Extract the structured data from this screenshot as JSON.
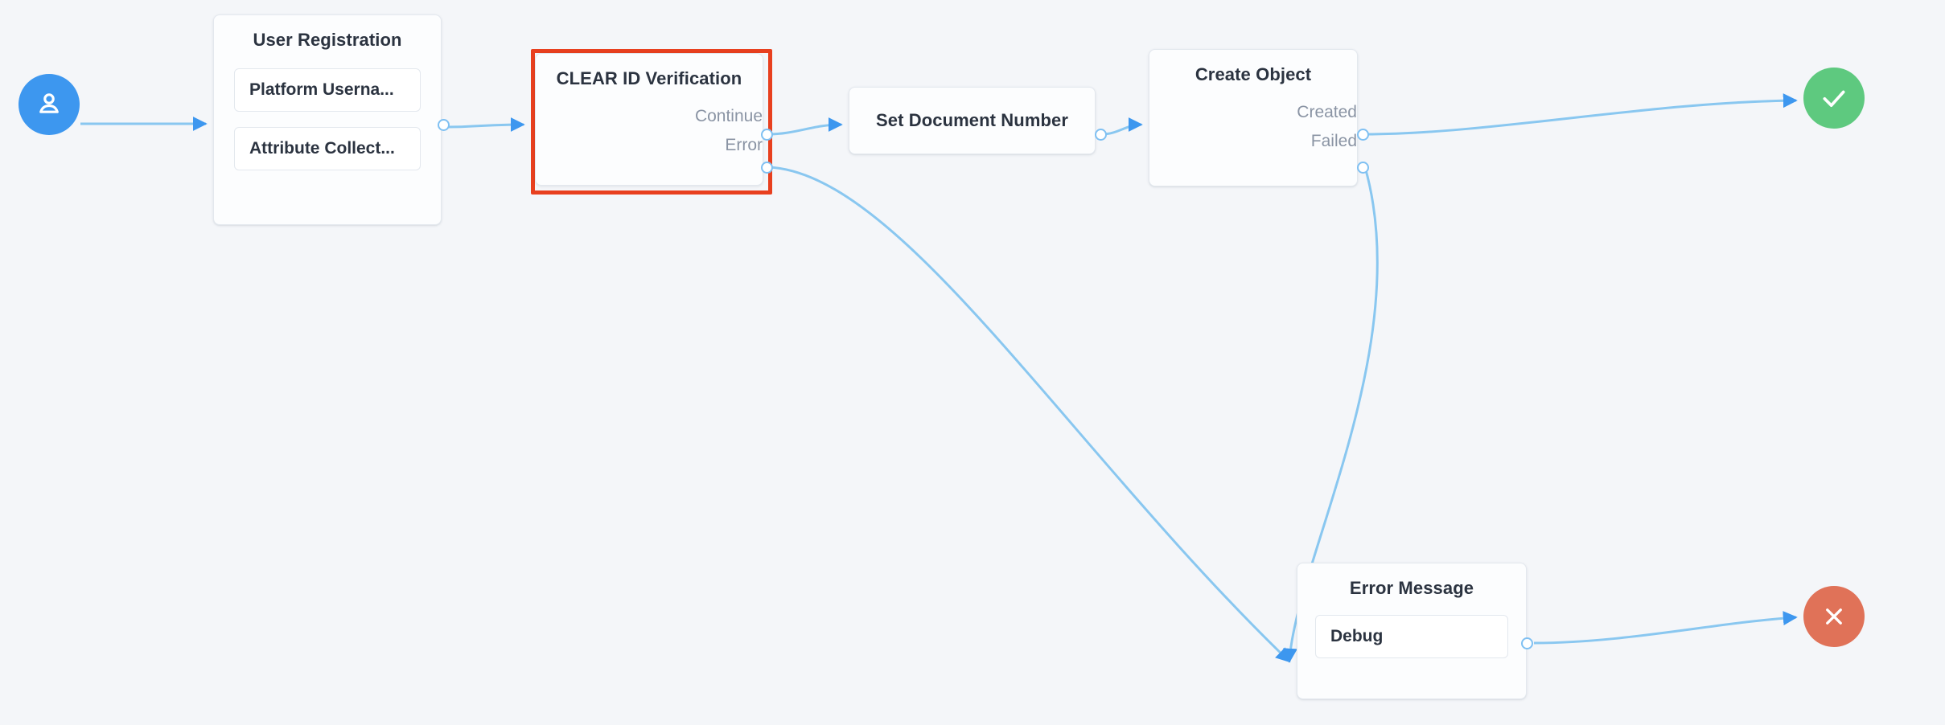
{
  "canvas": {
    "background": "#f4f6f9",
    "edge_color": "#89c7f0",
    "arrow_color": "#3d97ef"
  },
  "nodes": {
    "start": {
      "type": "terminal-start",
      "icon": "user-icon",
      "color": "#3d97ef"
    },
    "user_registration": {
      "title": "User Registration",
      "fields": [
        {
          "label": "Platform Userna..."
        },
        {
          "label": "Attribute Collect..."
        }
      ]
    },
    "clear_id_verification": {
      "title": "CLEAR ID Verification",
      "selected": true,
      "selection_color": "#e8401f",
      "ports": [
        {
          "label": "Continue"
        },
        {
          "label": "Error"
        }
      ]
    },
    "set_document_number": {
      "title": "Set Document Number"
    },
    "create_object": {
      "title": "Create Object",
      "ports": [
        {
          "label": "Created"
        },
        {
          "label": "Failed"
        }
      ]
    },
    "error_message": {
      "title": "Error Message",
      "fields": [
        {
          "label": "Debug"
        }
      ]
    },
    "success": {
      "type": "terminal-success",
      "icon": "check-icon",
      "color": "#5ec97f"
    },
    "failure": {
      "type": "terminal-failure",
      "icon": "close-icon",
      "color": "#e07258"
    }
  },
  "edges": [
    {
      "from": "start",
      "to": "user_registration"
    },
    {
      "from": "user_registration",
      "to": "clear_id_verification"
    },
    {
      "from": "clear_id_verification.Continue",
      "to": "set_document_number"
    },
    {
      "from": "clear_id_verification.Error",
      "to": "error_message"
    },
    {
      "from": "set_document_number",
      "to": "create_object"
    },
    {
      "from": "create_object.Created",
      "to": "success"
    },
    {
      "from": "create_object.Failed",
      "to": "error_message"
    },
    {
      "from": "error_message",
      "to": "failure"
    }
  ]
}
